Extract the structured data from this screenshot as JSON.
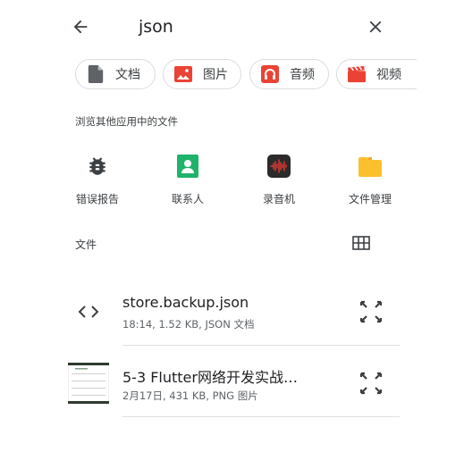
{
  "search": {
    "query": "json"
  },
  "chips": [
    {
      "label": "文档",
      "icon": "document-icon",
      "color": "#5f6368"
    },
    {
      "label": "图片",
      "icon": "image-icon",
      "color": "#ea4335"
    },
    {
      "label": "音频",
      "icon": "headphones-icon",
      "color": "#ea4335"
    },
    {
      "label": "视频",
      "icon": "clapperboard-icon",
      "color": "#ea4335"
    }
  ],
  "browse": {
    "label": "浏览其他应用中的文件",
    "apps": [
      {
        "label": "错误报告",
        "icon": "bug-icon"
      },
      {
        "label": "联系人",
        "icon": "contacts-icon",
        "color": "#1fb36b"
      },
      {
        "label": "录音机",
        "icon": "recorder-icon",
        "color": "#e53935"
      },
      {
        "label": "文件管理",
        "icon": "folder-icon",
        "color": "#fbc02d"
      }
    ]
  },
  "files": {
    "label": "文件",
    "items": [
      {
        "name": "store.backup.json",
        "meta": "18:14, 1.52 KB, JSON 文档",
        "icon": "code-icon"
      },
      {
        "name": "5-3 Flutter网络开发实战…",
        "meta": "2月17日, 431 KB, PNG 图片",
        "icon": "image-thumbnail"
      }
    ]
  }
}
